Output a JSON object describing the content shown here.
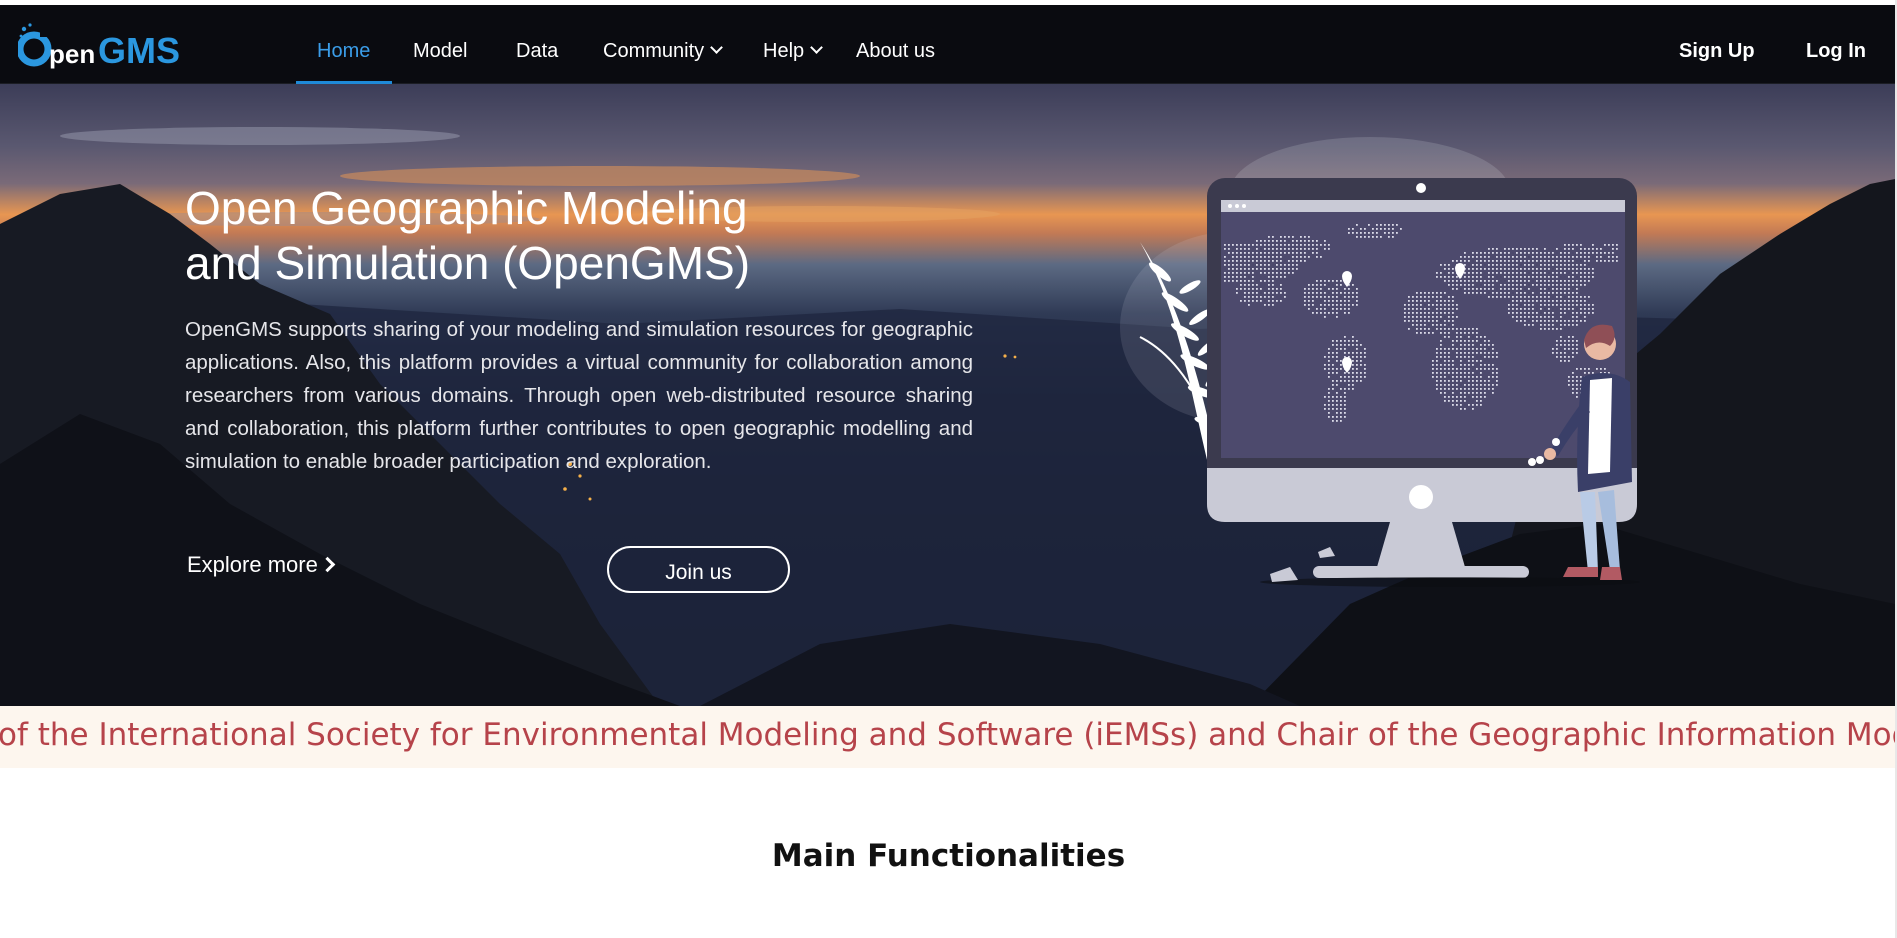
{
  "header": {
    "logo_text": "OpenGMS",
    "nav": [
      {
        "label": "Home",
        "active": true
      },
      {
        "label": "Model"
      },
      {
        "label": "Data"
      },
      {
        "label": "Community",
        "dropdown": true
      },
      {
        "label": "Help",
        "dropdown": true
      },
      {
        "label": "About us"
      }
    ],
    "sign_up": "Sign Up",
    "log_in": "Log In"
  },
  "hero": {
    "title_line1": "Open Geographic Modeling",
    "title_line2": "and Simulation (OpenGMS)",
    "description": "OpenGMS supports sharing of your modeling and simulation resources for geographic applications. Also, this platform provides a virtual community for collaboration among researchers from various domains. Through open web-distributed resource sharing and collaboration, this platform further contributes to open geographic modelling and simulation to enable broader participation and exploration.",
    "explore_label": "Explore more",
    "join_label": "Join us"
  },
  "ticker": {
    "text": "of the International Society for Environmental Modeling and Software (iEMSs) and Chair of the Geographic Information Modeling Co"
  },
  "main": {
    "section_title": "Main Functionalities"
  },
  "colors": {
    "nav_bg": "#0a0b10",
    "nav_active": "#3b9de8",
    "ticker_bg": "#fdf6ee",
    "ticker_text": "#b6434a",
    "logo_blue": "#2b97df"
  },
  "icons": {
    "dropdown": "chevron-down-icon",
    "explore": "chevron-right-icon"
  }
}
